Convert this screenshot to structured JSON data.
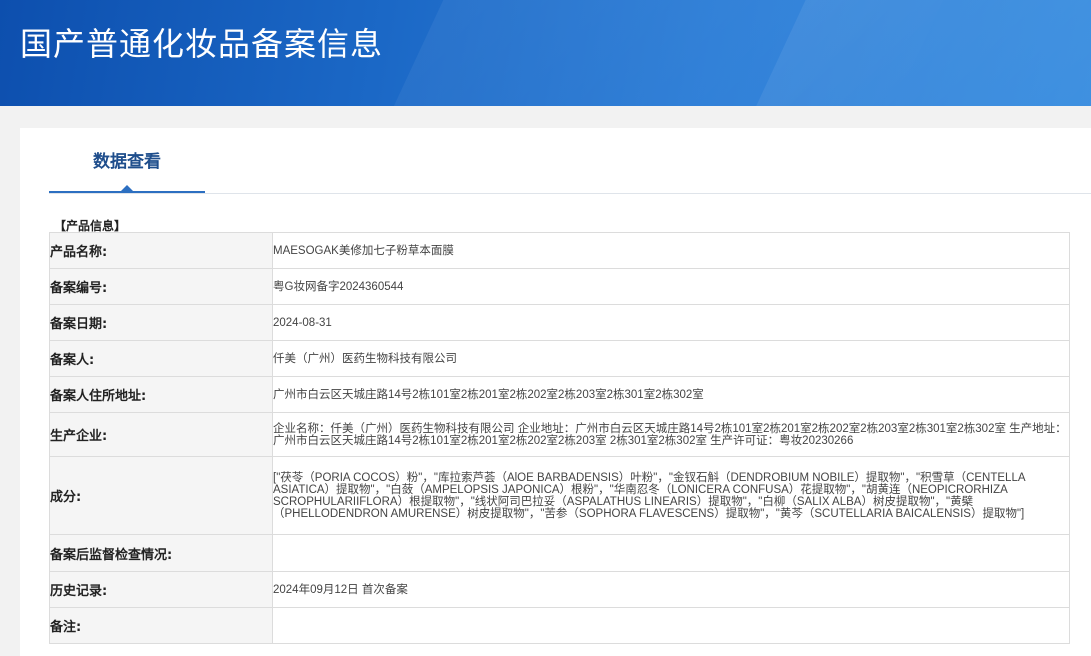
{
  "header": {
    "title": "国产普通化妆品备案信息"
  },
  "tabs": [
    {
      "label": "数据查看"
    }
  ],
  "section": {
    "title": "【产品信息】"
  },
  "rows": [
    {
      "label": "产品名称:",
      "value": "MAESOGAK美修加七子粉草本面膜"
    },
    {
      "label": "备案编号:",
      "value": "粤G妆网备字2024360544"
    },
    {
      "label": "备案日期:",
      "value": "2024-08-31"
    },
    {
      "label": "备案人:",
      "value": "仟美（广州）医药生物科技有限公司"
    },
    {
      "label": "备案人住所地址:",
      "value": "广州市白云区天城庄路14号2栋101室2栋201室2栋202室2栋203室2栋301室2栋302室"
    },
    {
      "label": "生产企业:",
      "value": "企业名称：仟美（广州）医药生物科技有限公司 企业地址：广州市白云区天城庄路14号2栋101室2栋201室2栋202室2栋203室2栋301室2栋302室 生产地址：广州市白云区天城庄路14号2栋101室2栋201室2栋202室2栋203室 2栋301室2栋302室 生产许可证：粤妆20230266"
    },
    {
      "label": "成分:",
      "value": "[\"茯苓（PORIA COCOS）粉\"，\"库拉索芦荟（AlOE BARBADENSIS）叶粉\"，\"金钗石斛（DENDROBIUM NOBILE）提取物\"，\"积雪草（CENTELLA ASIATICA）提取物\"，\"白蔹（AMPELOPSIS JAPONICA）根粉\"，\"华南忍冬（LONICERA CONFUSA）花提取物\"，\"胡黄连（NEOPICRORHIZA SCROPHULARIIFLORA）根提取物\"，\"线状阿司巴拉妥（ASPALATHUS LINEARIS）提取物\"，\"白柳（SALIX ALBA）树皮提取物\"，\"黄檗（PHELLODENDRON AMURENSE）树皮提取物\"，\"苦参（SOPHORA FLAVESCENS）提取物\"，\"黄芩（SCUTELLARIA BAICALENSIS）提取物\"]"
    },
    {
      "label": "备案后监督检查情况:",
      "value": ""
    },
    {
      "label": "历史记录:",
      "value": "2024年09月12日 首次备案"
    },
    {
      "label": "备注:",
      "value": ""
    }
  ]
}
